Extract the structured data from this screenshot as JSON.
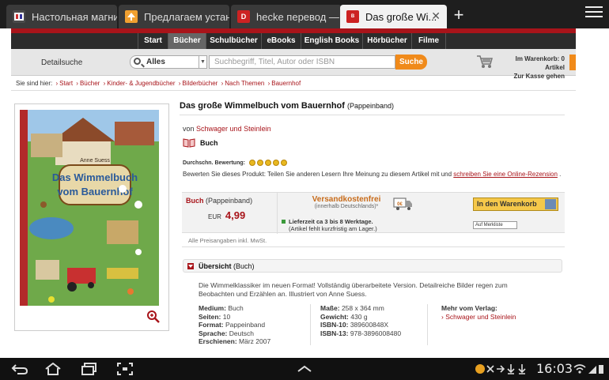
{
  "browser": {
    "tabs": [
      {
        "title": "Настольная магнит...",
        "icon": "bookmark-tab-icon",
        "color": "#ffffff"
      },
      {
        "title": "Предлагаем устано...",
        "icon": "arrow-tab-icon",
        "color": "#f0a030"
      },
      {
        "title": "hecke перевод — Я...",
        "icon": "d-tab-icon",
        "color": "#cc2222"
      },
      {
        "title": "Das große Wi...",
        "icon": "buecher-tab-icon",
        "color": "#cc2222"
      }
    ],
    "active_tab": 3,
    "new_tab_label": "+"
  },
  "site": {
    "nav": [
      "Start",
      "Bücher",
      "Schulbücher",
      "eBooks",
      "English Books",
      "Hörbücher",
      "Filme"
    ],
    "nav_active": 1,
    "detail_search": "Detailsuche",
    "search_scope": "Alles",
    "search_placeholder": "Suchbegriff, Titel, Autor oder ISBN",
    "search_button": "Suche",
    "cart_line1": "Im Warenkorb: 0 Artikel",
    "cart_line2": "Zur Kasse gehen"
  },
  "breadcrumb": {
    "prefix": "Sie sind hier:",
    "items": [
      "Start",
      "Bücher",
      "Kinder- & Jugendbücher",
      "Bilderbücher",
      "Nach Themen",
      "Bauernhof"
    ]
  },
  "product": {
    "title": "Das große Wimmelbuch vom Bauernhof",
    "format": "(Pappeinband)",
    "author_prefix": "von",
    "author": "Schwager und Steinlein",
    "type": "Buch",
    "rating_label": "Durchschn. Bewertung:",
    "review_text": "Bewerten Sie dieses Produkt: Teilen Sie anderen Lesern Ihre Meinung zu diesem Artikel mit und",
    "review_link": "schreiben Sie eine Online-Rezension",
    "review_end": ".",
    "cover_author": "Anne Suess",
    "cover_title1": "Das Wimmelbuch",
    "cover_title2": "vom Bauernhof"
  },
  "price": {
    "type": "Buch",
    "format": "(Pappeinband)",
    "currency": "EUR",
    "amount": "4,99",
    "shipping": "Versandkostenfrei",
    "shipping_sub": "(innerhalb Deutschlands)",
    "shipping_mark": "*",
    "truck_label": "0€",
    "delivery": "Lieferzeit ca 3 bis 8 Werktage.",
    "delivery_sub": "(Artikel fehlt kurzfristig am Lager.)",
    "cart_button": "In den Warenkorb",
    "merkliste": "Auf Merkliste",
    "mwst": "Alle Preisangaben inkl. MwSt."
  },
  "overview": {
    "title": "Übersicht",
    "title_sub": "(Buch)",
    "description": "Die Wimmelklassiker im neuen Format! Vollständig überarbeitete Version. Detailreiche Bilder regen zum Beobachten und Erzählen an. Illustriert von Anne Suess.",
    "col1": [
      {
        "label": "Medium:",
        "value": "Buch"
      },
      {
        "label": "Seiten:",
        "value": "10"
      },
      {
        "label": "Format:",
        "value": "Pappeinband"
      },
      {
        "label": "Sprache:",
        "value": "Deutsch"
      },
      {
        "label": "Erschienen:",
        "value": "März 2007"
      }
    ],
    "col2": [
      {
        "label": "Maße:",
        "value": "258 x 364 mm"
      },
      {
        "label": "Gewicht:",
        "value": "430 g"
      },
      {
        "label": "ISBN-10:",
        "value": "389600848X"
      },
      {
        "label": "ISBN-13:",
        "value": "978-3896008480"
      }
    ],
    "col3_label": "Mehr vom Verlag:",
    "col3_link": "Schwager und Steinlein"
  },
  "status": {
    "clock": "16:03"
  }
}
